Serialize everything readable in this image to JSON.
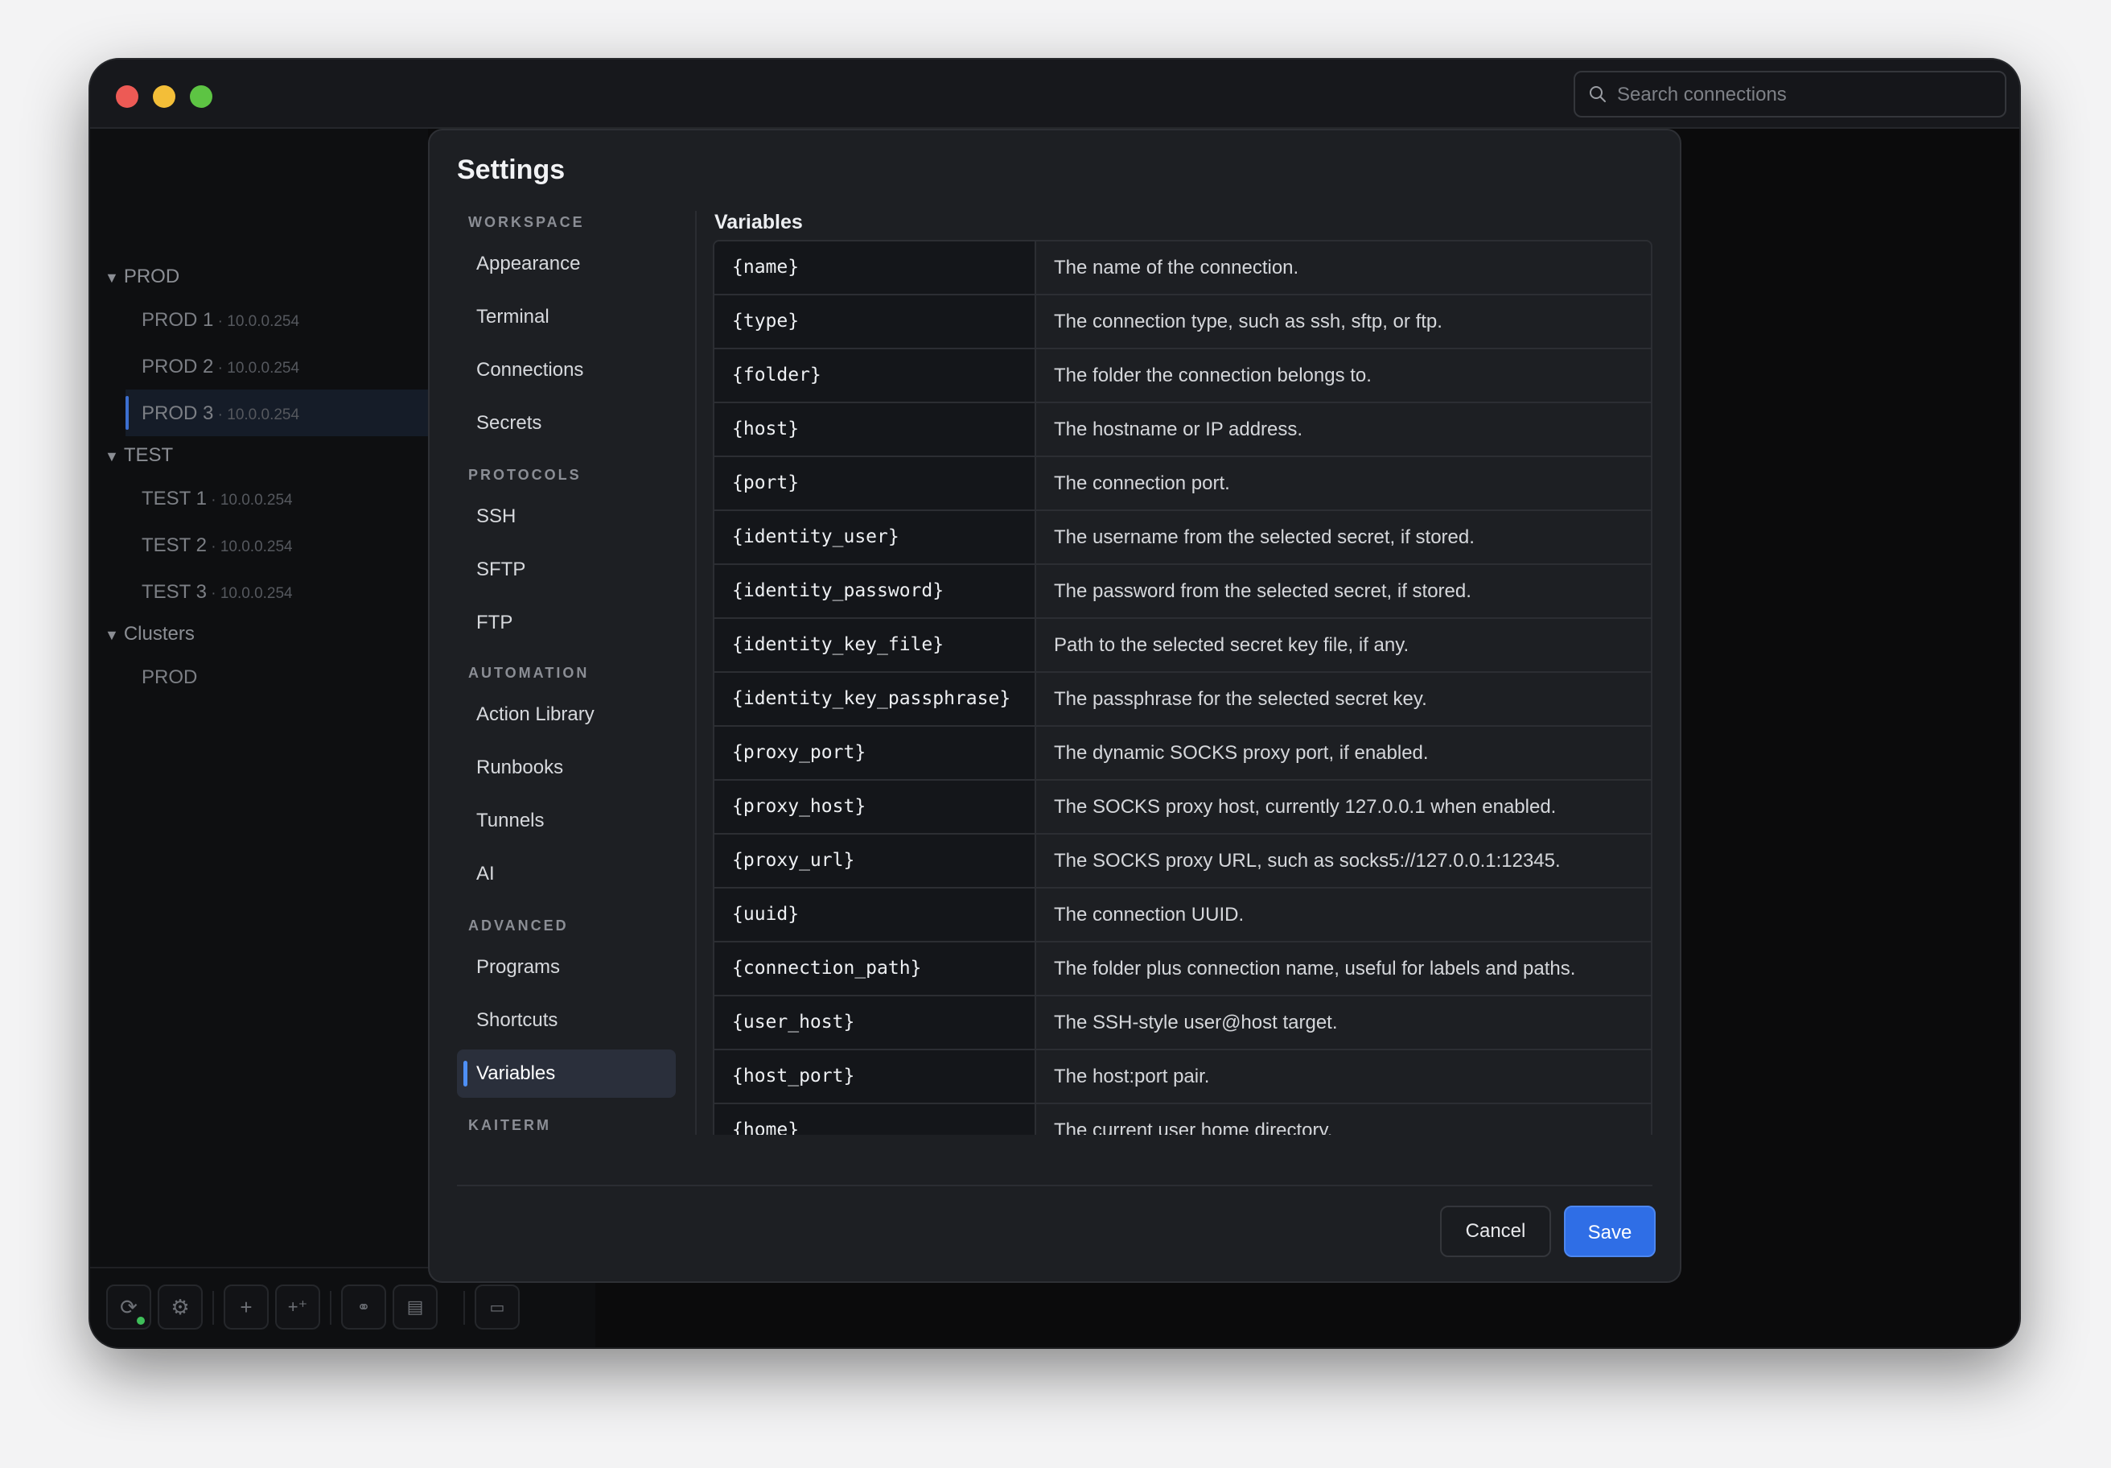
{
  "window": {
    "traffic_lights": {
      "close": "#ed5a55",
      "minimize": "#f3be38",
      "maximize": "#5dc443"
    }
  },
  "search": {
    "placeholder": "Search connections"
  },
  "sidebar": {
    "folders": [
      {
        "label": "PROD",
        "items": [
          {
            "name": "PROD 1",
            "ip": "10.0.0.254"
          },
          {
            "name": "PROD 2",
            "ip": "10.0.0.254"
          },
          {
            "name": "PROD 3",
            "ip": "10.0.0.254",
            "selected": true
          }
        ]
      },
      {
        "label": "TEST",
        "items": [
          {
            "name": "TEST 1",
            "ip": "10.0.0.254"
          },
          {
            "name": "TEST 2",
            "ip": "10.0.0.254"
          },
          {
            "name": "TEST 3",
            "ip": "10.0.0.254"
          }
        ]
      },
      {
        "label": "Clusters",
        "items": [
          {
            "name": "PROD"
          }
        ]
      }
    ]
  },
  "toolbar": {
    "buttons": [
      "sync-icon",
      "gear-icon",
      "plus-icon",
      "plus-sparkle-icon",
      "link-icon",
      "document-icon",
      "terminal-icon"
    ]
  },
  "settings": {
    "title": "Settings",
    "sections": [
      {
        "label": "WORKSPACE",
        "items": [
          "Appearance",
          "Terminal",
          "Connections",
          "Secrets"
        ]
      },
      {
        "label": "PROTOCOLS",
        "items": [
          "SSH",
          "SFTP",
          "FTP"
        ]
      },
      {
        "label": "AUTOMATION",
        "items": [
          "Action Library",
          "Runbooks",
          "Tunnels",
          "AI"
        ]
      },
      {
        "label": "ADVANCED",
        "items": [
          "Programs",
          "Shortcuts",
          "Variables"
        ]
      },
      {
        "label": "KAITERM",
        "items": []
      }
    ],
    "active_item": "Variables",
    "content_title": "Variables",
    "variables": [
      {
        "name": "{name}",
        "desc": "The name of the connection."
      },
      {
        "name": "{type}",
        "desc": "The connection type, such as ssh, sftp, or ftp."
      },
      {
        "name": "{folder}",
        "desc": "The folder the connection belongs to."
      },
      {
        "name": "{host}",
        "desc": "The hostname or IP address."
      },
      {
        "name": "{port}",
        "desc": "The connection port."
      },
      {
        "name": "{identity_user}",
        "desc": "The username from the selected secret, if stored."
      },
      {
        "name": "{identity_password}",
        "desc": "The password from the selected secret, if stored."
      },
      {
        "name": "{identity_key_file}",
        "desc": "Path to the selected secret key file, if any."
      },
      {
        "name": "{identity_key_passphrase}",
        "desc": "The passphrase for the selected secret key."
      },
      {
        "name": "{proxy_port}",
        "desc": "The dynamic SOCKS proxy port, if enabled."
      },
      {
        "name": "{proxy_host}",
        "desc": "The SOCKS proxy host, currently 127.0.0.1 when enabled."
      },
      {
        "name": "{proxy_url}",
        "desc": "The SOCKS proxy URL, such as socks5://127.0.0.1:12345."
      },
      {
        "name": "{uuid}",
        "desc": "The connection UUID."
      },
      {
        "name": "{connection_path}",
        "desc": "The folder plus connection name, useful for labels and paths."
      },
      {
        "name": "{user_host}",
        "desc": "The SSH-style user@host target."
      },
      {
        "name": "{host_port}",
        "desc": "The host:port pair."
      },
      {
        "name": "{home}",
        "desc": "The current user home directory."
      }
    ],
    "buttons": {
      "cancel": "Cancel",
      "save": "Save"
    },
    "accent_color": "#2f6ee6"
  }
}
